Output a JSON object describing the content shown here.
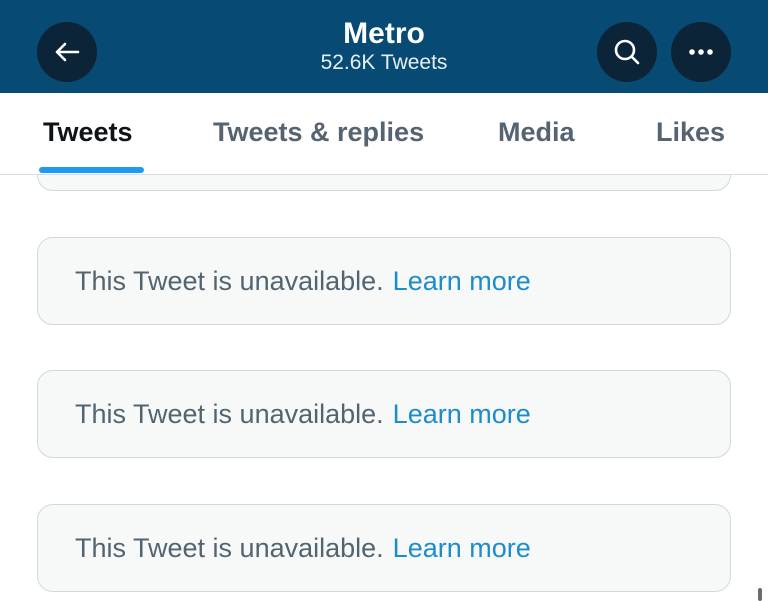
{
  "header": {
    "title": "Metro",
    "subtitle": "52.6K Tweets",
    "background": "#074a73",
    "buttons": {
      "back_icon": "arrow-left-icon",
      "search_icon": "search-icon",
      "more_icon": "more-horizontal-icon"
    }
  },
  "tabs": [
    {
      "label": "Tweets",
      "active": true
    },
    {
      "label": "Tweets & replies",
      "active": false
    },
    {
      "label": "Media",
      "active": false
    },
    {
      "label": "Likes",
      "active": false
    }
  ],
  "accent": "#1d9bf0",
  "timeline": {
    "items": [
      {
        "text": "This Tweet is unavailable.",
        "link": "Learn more"
      },
      {
        "text": "This Tweet is unavailable.",
        "link": "Learn more"
      },
      {
        "text": "This Tweet is unavailable.",
        "link": "Learn more"
      }
    ]
  }
}
